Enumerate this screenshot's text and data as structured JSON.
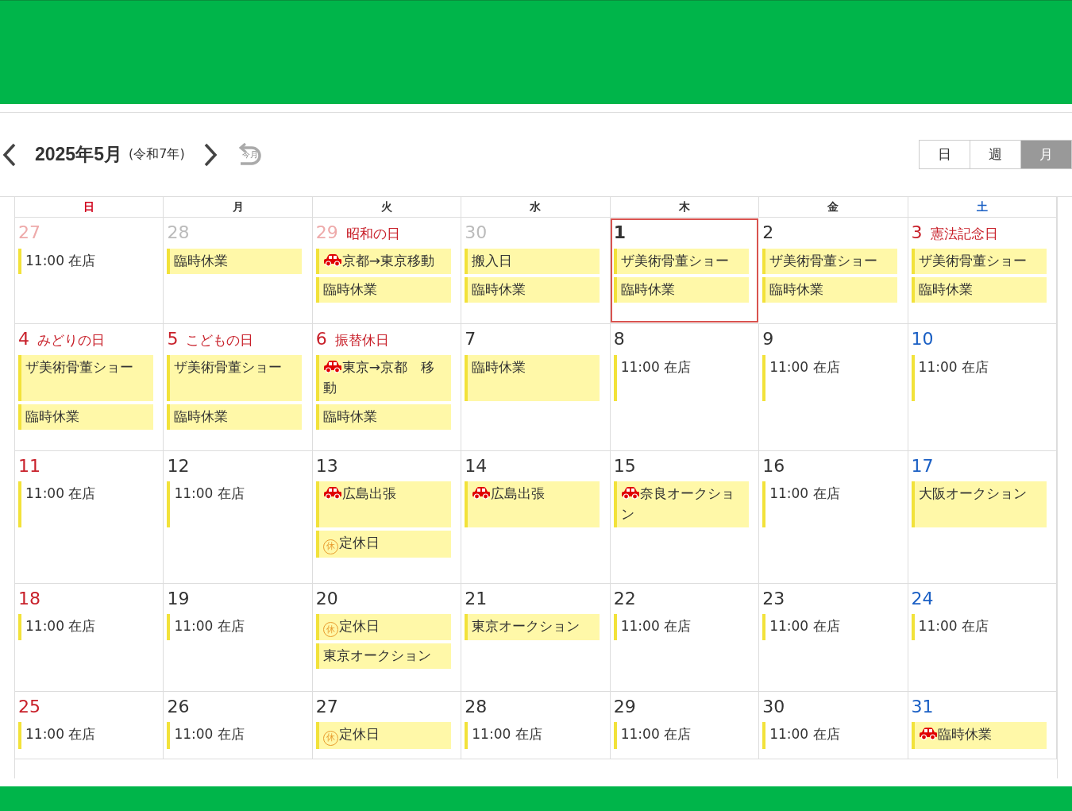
{
  "header": {
    "title": "2025年5月",
    "era": "(令和7年)",
    "today_label": "今月"
  },
  "view_tabs": [
    {
      "label": "日",
      "selected": false
    },
    {
      "label": "週",
      "selected": false
    },
    {
      "label": "月",
      "selected": true
    }
  ],
  "weekdays": [
    {
      "label": "日",
      "kind": "sunday"
    },
    {
      "label": "月",
      "kind": "weekday"
    },
    {
      "label": "火",
      "kind": "weekday"
    },
    {
      "label": "水",
      "kind": "weekday"
    },
    {
      "label": "木",
      "kind": "weekday"
    },
    {
      "label": "金",
      "kind": "weekday"
    },
    {
      "label": "土",
      "kind": "saturday"
    }
  ],
  "weeks": [
    {
      "days": [
        {
          "number": "27",
          "kind": "holiday",
          "other_month": true,
          "today": false,
          "events": [
            {
              "text": "11:00 在店",
              "kind": "line"
            }
          ]
        },
        {
          "number": "28",
          "kind": "weekday",
          "other_month": true,
          "today": false,
          "events": [
            {
              "text": "臨時休業",
              "kind": "block"
            }
          ]
        },
        {
          "number": "29",
          "holiday": "昭和の日",
          "kind": "holiday",
          "other_month": true,
          "today": false,
          "events": [
            {
              "text": "京都→東京移動",
              "kind": "trip"
            },
            {
              "text": "臨時休業",
              "kind": "block"
            }
          ]
        },
        {
          "number": "30",
          "kind": "weekday",
          "other_month": true,
          "today": false,
          "events": [
            {
              "text": "搬入日",
              "kind": "block"
            },
            {
              "text": "臨時休業",
              "kind": "block"
            }
          ]
        },
        {
          "number": "1",
          "kind": "weekday",
          "other_month": false,
          "today": true,
          "events": [
            {
              "text": "ザ美術骨董ショー",
              "kind": "block"
            },
            {
              "text": "臨時休業",
              "kind": "block"
            }
          ]
        },
        {
          "number": "2",
          "kind": "weekday",
          "other_month": false,
          "today": false,
          "events": [
            {
              "text": "ザ美術骨董ショー",
              "kind": "block"
            },
            {
              "text": "臨時休業",
              "kind": "block"
            }
          ]
        },
        {
          "number": "3",
          "holiday": "憲法記念日",
          "kind": "holiday",
          "other_month": false,
          "today": false,
          "events": [
            {
              "text": "ザ美術骨董ショー",
              "kind": "block"
            },
            {
              "text": "臨時休業",
              "kind": "block"
            }
          ]
        }
      ]
    },
    {
      "days": [
        {
          "number": "4",
          "holiday": "みどりの日",
          "kind": "holiday",
          "other_month": false,
          "today": false,
          "events": [
            {
              "text": "ザ美術骨董ショー",
              "kind": "block"
            },
            {
              "text": "臨時休業",
              "kind": "block"
            }
          ]
        },
        {
          "number": "5",
          "holiday": "こどもの日",
          "kind": "holiday",
          "other_month": false,
          "today": false,
          "events": [
            {
              "text": "ザ美術骨董ショー",
              "kind": "block"
            },
            {
              "text": "臨時休業",
              "kind": "block"
            }
          ]
        },
        {
          "number": "6",
          "holiday": "振替休日",
          "kind": "holiday",
          "other_month": false,
          "today": false,
          "events": [
            {
              "text": "東京→京都　移動",
              "kind": "trip"
            },
            {
              "text": "臨時休業",
              "kind": "block"
            }
          ]
        },
        {
          "number": "7",
          "kind": "weekday",
          "other_month": false,
          "today": false,
          "events": [
            {
              "text": "臨時休業",
              "kind": "block"
            }
          ]
        },
        {
          "number": "8",
          "kind": "weekday",
          "other_month": false,
          "today": false,
          "events": [
            {
              "text": "11:00 在店",
              "kind": "line"
            }
          ]
        },
        {
          "number": "9",
          "kind": "weekday",
          "other_month": false,
          "today": false,
          "events": [
            {
              "text": "11:00 在店",
              "kind": "line"
            }
          ]
        },
        {
          "number": "10",
          "kind": "saturday",
          "other_month": false,
          "today": false,
          "events": [
            {
              "text": "11:00 在店",
              "kind": "line"
            }
          ]
        }
      ]
    },
    {
      "days": [
        {
          "number": "11",
          "kind": "holiday",
          "other_month": false,
          "today": false,
          "events": [
            {
              "text": "11:00 在店",
              "kind": "line"
            }
          ]
        },
        {
          "number": "12",
          "kind": "weekday",
          "other_month": false,
          "today": false,
          "events": [
            {
              "text": "11:00 在店",
              "kind": "line"
            }
          ]
        },
        {
          "number": "13",
          "kind": "weekday",
          "other_month": false,
          "today": false,
          "events": [
            {
              "text": "広島出張",
              "kind": "trip"
            },
            {
              "text": "定休日",
              "kind": "closed",
              "badge": "休"
            }
          ]
        },
        {
          "number": "14",
          "kind": "weekday",
          "other_month": false,
          "today": false,
          "events": [
            {
              "text": "広島出張",
              "kind": "trip"
            }
          ]
        },
        {
          "number": "15",
          "kind": "weekday",
          "other_month": false,
          "today": false,
          "events": [
            {
              "text": "奈良オークション",
              "kind": "trip"
            }
          ]
        },
        {
          "number": "16",
          "kind": "weekday",
          "other_month": false,
          "today": false,
          "events": [
            {
              "text": "11:00 在店",
              "kind": "line"
            }
          ]
        },
        {
          "number": "17",
          "kind": "saturday",
          "other_month": false,
          "today": false,
          "events": [
            {
              "text": "大阪オークション",
              "kind": "block"
            }
          ]
        }
      ]
    },
    {
      "days": [
        {
          "number": "18",
          "kind": "holiday",
          "other_month": false,
          "today": false,
          "events": [
            {
              "text": "11:00 在店",
              "kind": "line"
            }
          ]
        },
        {
          "number": "19",
          "kind": "weekday",
          "other_month": false,
          "today": false,
          "events": [
            {
              "text": "11:00 在店",
              "kind": "line"
            }
          ]
        },
        {
          "number": "20",
          "kind": "weekday",
          "other_month": false,
          "today": false,
          "events": [
            {
              "text": "定休日",
              "kind": "closed",
              "badge": "休"
            },
            {
              "text": "東京オークション",
              "kind": "block"
            }
          ]
        },
        {
          "number": "21",
          "kind": "weekday",
          "other_month": false,
          "today": false,
          "events": [
            {
              "text": "東京オークション",
              "kind": "block"
            }
          ]
        },
        {
          "number": "22",
          "kind": "weekday",
          "other_month": false,
          "today": false,
          "events": [
            {
              "text": "11:00 在店",
              "kind": "line"
            }
          ]
        },
        {
          "number": "23",
          "kind": "weekday",
          "other_month": false,
          "today": false,
          "events": [
            {
              "text": "11:00 在店",
              "kind": "line"
            }
          ]
        },
        {
          "number": "24",
          "kind": "saturday",
          "other_month": false,
          "today": false,
          "events": [
            {
              "text": "11:00 在店",
              "kind": "line"
            }
          ]
        }
      ]
    },
    {
      "days": [
        {
          "number": "25",
          "kind": "holiday",
          "other_month": false,
          "today": false,
          "events": [
            {
              "text": "11:00 在店",
              "kind": "line"
            }
          ]
        },
        {
          "number": "26",
          "kind": "weekday",
          "other_month": false,
          "today": false,
          "events": [
            {
              "text": "11:00 在店",
              "kind": "line"
            }
          ]
        },
        {
          "number": "27",
          "kind": "weekday",
          "other_month": false,
          "today": false,
          "events": [
            {
              "text": "定休日",
              "kind": "closed",
              "badge": "休"
            }
          ]
        },
        {
          "number": "28",
          "kind": "weekday",
          "other_month": false,
          "today": false,
          "events": [
            {
              "text": "11:00 在店",
              "kind": "line"
            }
          ]
        },
        {
          "number": "29",
          "kind": "weekday",
          "other_month": false,
          "today": false,
          "events": [
            {
              "text": "11:00 在店",
              "kind": "line"
            }
          ]
        },
        {
          "number": "30",
          "kind": "weekday",
          "other_month": false,
          "today": false,
          "events": [
            {
              "text": "11:00 在店",
              "kind": "line"
            }
          ]
        },
        {
          "number": "31",
          "kind": "saturday",
          "other_month": false,
          "today": false,
          "events": [
            {
              "text": "臨時休業",
              "kind": "trip"
            }
          ]
        }
      ]
    }
  ]
}
